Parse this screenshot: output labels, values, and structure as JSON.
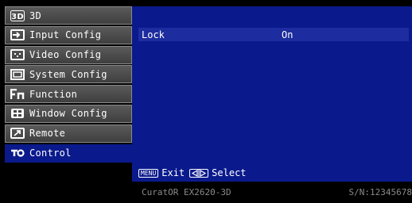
{
  "sidebar": {
    "items": [
      {
        "label": "3D",
        "icon": "3d-icon"
      },
      {
        "label": "Input Config",
        "icon": "input-icon"
      },
      {
        "label": "Video Config",
        "icon": "video-icon"
      },
      {
        "label": "System Config",
        "icon": "system-icon"
      },
      {
        "label": "Function",
        "icon": "function-icon"
      },
      {
        "label": "Window Config",
        "icon": "window-icon"
      },
      {
        "label": "Remote",
        "icon": "remote-icon"
      },
      {
        "label": "Control",
        "icon": "control-icon"
      }
    ],
    "active_index": 7
  },
  "panel": {
    "setting": {
      "name": "Lock",
      "value": "On"
    },
    "help": {
      "menu_key": "MENU",
      "exit_label": "Exit",
      "select_label": "Select"
    }
  },
  "footer": {
    "model": "CuratOR EX2620-3D",
    "serial": "S/N:12345678"
  },
  "colors": {
    "accent": "#0a1a8c",
    "row_highlight": "#1d2c9e",
    "menu_item": "#4a4a4a",
    "footer_text": "#8a8a8a"
  }
}
